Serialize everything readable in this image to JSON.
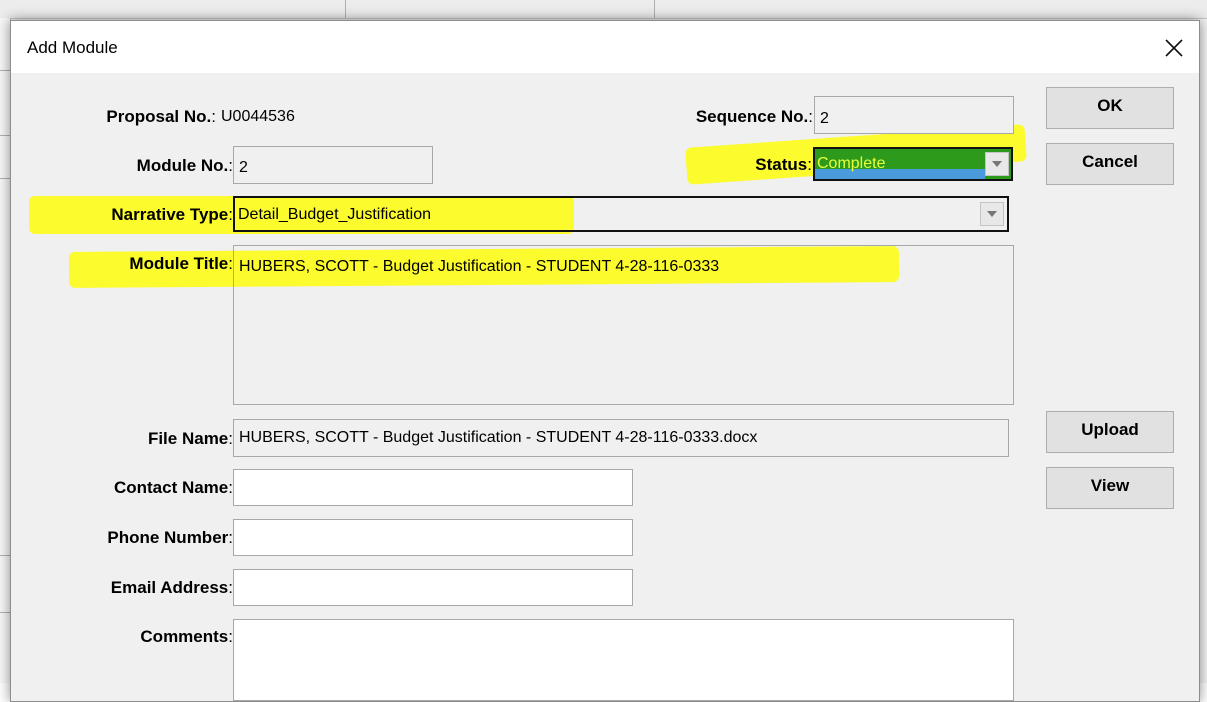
{
  "dialog": {
    "title": "Add Module"
  },
  "form": {
    "proposal_no": {
      "label": "Proposal No.",
      "value": "U0044536"
    },
    "sequence_no": {
      "label": "Sequence No.",
      "value": "2"
    },
    "module_no": {
      "label": "Module No.",
      "value": "2"
    },
    "status": {
      "label": "Status",
      "value": "Complete"
    },
    "narrative_type": {
      "label": "Narrative Type",
      "value": "Detail_Budget_Justification"
    },
    "module_title": {
      "label": "Module Title",
      "value": "HUBERS, SCOTT - Budget Justification - STUDENT 4-28-116-0333"
    },
    "file_name": {
      "label": "File Name",
      "value": "HUBERS, SCOTT - Budget Justification - STUDENT 4-28-116-0333.docx"
    },
    "contact_name": {
      "label": "Contact Name",
      "value": ""
    },
    "phone_number": {
      "label": "Phone Number",
      "value": ""
    },
    "email_address": {
      "label": "Email Address",
      "value": ""
    },
    "comments": {
      "label": "Comments",
      "value": ""
    }
  },
  "buttons": {
    "ok": "OK",
    "cancel": "Cancel",
    "upload": "Upload",
    "view": "View"
  },
  "colors": {
    "status_fill": "#2e9a1c",
    "status_text": "#e6ff3c",
    "highlight": "#fbfb2e"
  }
}
